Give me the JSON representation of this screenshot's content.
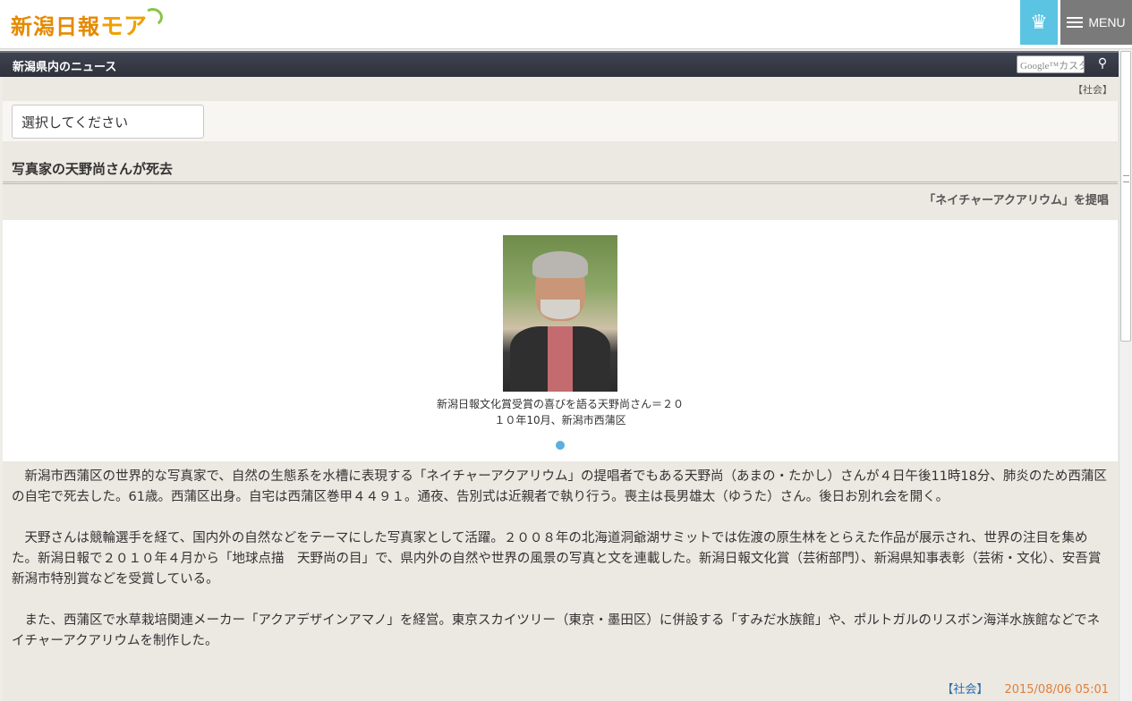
{
  "header": {
    "logo_text": "新潟日報",
    "logo_mo": "モア",
    "crown_icon": "crown-icon",
    "menu_label": "MENU"
  },
  "section_bar": {
    "title": "新潟県内のニュース",
    "search_placeholder": "Google™カスタム検索",
    "pin_icon": "map-pin-icon"
  },
  "article": {
    "category_top": "【社会】",
    "select_placeholder": "選択してください",
    "headline": "写真家の天野尚さんが死去",
    "subhead": "「ネイチャーアクアリウム」を提唱",
    "photo_caption": "新潟日報文化賞受賞の喜びを語る天野尚さん＝２０１０年10月、新潟市西蒲区",
    "paragraphs": [
      "新潟市西蒲区の世界的な写真家で、自然の生態系を水槽に表現する「ネイチャーアクアリウム」の提唱者でもある天野尚（あまの・たかし）さんが４日午後11時18分、肺炎のため西蒲区の自宅で死去した。61歳。西蒲区出身。自宅は西蒲区巻甲４４９１。通夜、告別式は近親者で執り行う。喪主は長男雄太（ゆうた）さん。後日お別れ会を開く。",
      "天野さんは競輪選手を経て、国内外の自然などをテーマにした写真家として活躍。２００８年の北海道洞爺湖サミットでは佐渡の原生林をとらえた作品が展示され、世界の注目を集めた。新潟日報で２０１０年４月から「地球点描　天野尚の目」で、県内外の自然や世界の風景の写真と文を連載した。新潟日報文化賞（芸術部門）、新潟県知事表彰（芸術・文化）、安吾賞新潟市特別賞などを受賞している。",
      "また、西蒲区で水草栽培関連メーカー「アクアデザインアマノ」を経営。東京スカイツリー（東京・墨田区）に併設する「すみだ水族館」や、ポルトガルのリスボン海洋水族館などでネイチャーアクアリウムを制作した。"
    ],
    "footer_category": "【社会】",
    "footer_date": "2015/08/06 05:01"
  },
  "colors": {
    "accent_blue": "#5bc4e3",
    "logo_orange": "#e58a00",
    "date_orange": "#e0803a",
    "link_blue": "#2a6fb0"
  }
}
